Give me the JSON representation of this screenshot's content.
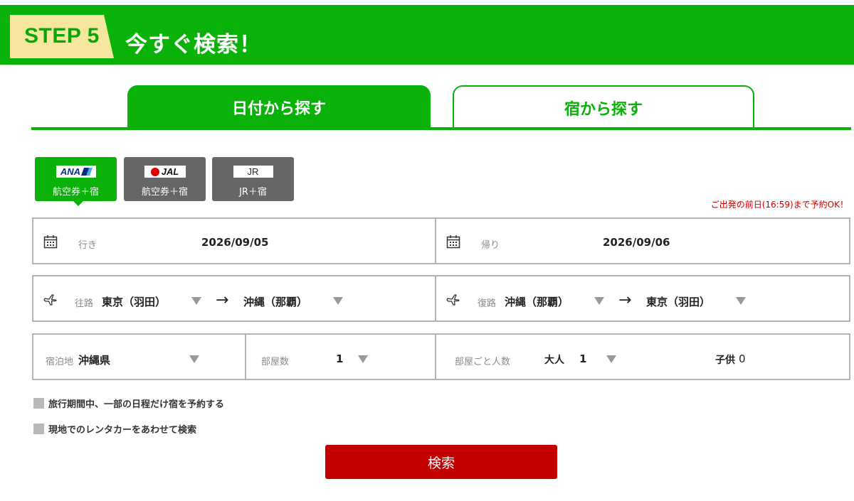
{
  "header": {
    "step": "STEP 5",
    "title": "今すぐ検索！"
  },
  "tabs": [
    {
      "label": "日付から探す",
      "active": true
    },
    {
      "label": "宿から探す",
      "active": false
    }
  ],
  "modes": [
    {
      "logo": "ANA",
      "label": "航空券＋宿",
      "active": true
    },
    {
      "logo": "JAL",
      "label": "航空券＋宿",
      "active": false
    },
    {
      "logo": "JR",
      "label": "JR＋宿",
      "active": false
    }
  ],
  "notice": "ご出発の前日(16:59)まで予約OK！",
  "dates": {
    "depart_label": "行き",
    "depart_value": "2026/09/05",
    "return_label": "帰り",
    "return_value": "2026/09/06"
  },
  "routes": {
    "outbound_label": "往路",
    "outbound_from": "東京（羽田）",
    "outbound_to": "沖縄（那覇）",
    "return_label": "復路",
    "return_from": "沖縄（那覇）",
    "return_to": "東京（羽田）",
    "arrow": "→"
  },
  "stay": {
    "location_label": "宿泊地",
    "location_value": "沖縄県",
    "rooms_label": "部屋数",
    "rooms_value": "1",
    "people_label": "部屋ごと人数",
    "adults_label": "大人",
    "adults_value": "1",
    "children_label": "子供",
    "children_value": "0"
  },
  "options": [
    {
      "label": "旅行期間中、一部の日程だけ宿を予約する",
      "checked": false
    },
    {
      "label": "現地でのレンタカーをあわせて検索",
      "checked": false
    }
  ],
  "search_button": "検索",
  "colors": {
    "brand_green": "#09b109",
    "search_red": "#c20000",
    "notice_red": "#cc0000",
    "inactive_gray": "#666666"
  }
}
